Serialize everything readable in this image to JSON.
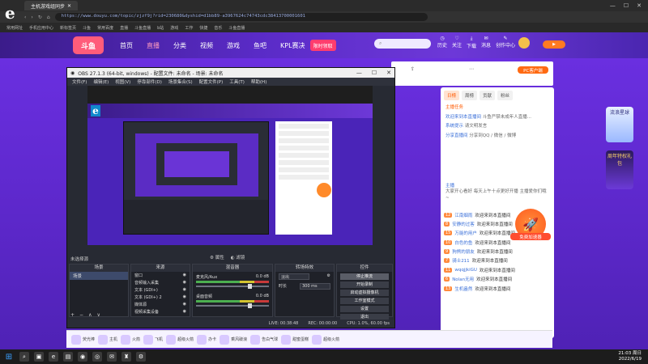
{
  "browser": {
    "tab_title": "主机游戏组同步",
    "url": "https://www.douyu.com/topic/zjzf9j?rid=230680&dyshid=d1bb89-a3967624c74743cdc38413700001601",
    "bookmarks": [
      "常用网址",
      "手机应用中心",
      "新标签页",
      "斗鱼",
      "常用百度",
      "直播",
      "斗鱼直播",
      "b站",
      "游戏",
      "工作",
      "快捷",
      "音乐",
      "斗鱼直播"
    ]
  },
  "site": {
    "brand": "斗鱼",
    "nav": [
      "首页",
      "直播",
      "分类",
      "视频",
      "游戏",
      "鱼吧",
      "KPL赛决"
    ],
    "search_placeholder": "",
    "promo": "限时领取",
    "tools": [
      "历史",
      "关注",
      "下载",
      "消息",
      "创作中心"
    ],
    "pc_button": "PC客户端"
  },
  "chat": {
    "tabs": [
      "日榜",
      "周榜",
      "贡献",
      "粉丝"
    ],
    "banner": "主播任务",
    "messages": [
      {
        "name": "欢迎来到本直播间",
        "text": "斗鱼严禁未成年人直播..."
      },
      {
        "name": "系统提示",
        "text": "请文明发言"
      },
      {
        "name": "分享直播间",
        "text": "分享到QQ / 微信 / 微博"
      }
    ],
    "announce_title": "主播",
    "announce_text": "大家开心看好 每天上午十点更好开播 主播爱你们哦~",
    "rocket_label": "免费加速器",
    "joins": [
      {
        "lv": "12",
        "name": "江南烟雨",
        "text": "欢迎来到本直播间"
      },
      {
        "lv": "8",
        "name": "安静的过客",
        "text": "欢迎来到本直播间"
      },
      {
        "lv": "15",
        "name": "万能的用户",
        "text": "欢迎来到本直播间"
      },
      {
        "lv": "10",
        "name": "白色的鱼",
        "text": "欢迎来到本直播间"
      },
      {
        "lv": "9",
        "name": "狗熊的朋友",
        "text": "欢迎来到本直播间"
      },
      {
        "lv": "7",
        "name": "骑士211",
        "text": "欢迎来到本直播间"
      },
      {
        "lv": "11",
        "name": "wqqjjkiGU",
        "text": "欢迎来到本直播间"
      },
      {
        "lv": "6",
        "name": "Nolan无用",
        "text": "欢迎来到本直播间"
      },
      {
        "lv": "13",
        "name": "生机盎然",
        "text": "欢迎来到本直播间"
      }
    ]
  },
  "side": {
    "promo1": "流浪星球",
    "promo2": "周年特权礼包"
  },
  "obs": {
    "title": "OBS 27.1.3 (64-bit, windows) - 配置文件: 未命名 - 场景: 未命名",
    "menu": [
      "文件(F)",
      "编辑(E)",
      "视图(V)",
      "停靠部件(D)",
      "场景集合(S)",
      "配置文件(P)",
      "工具(T)",
      "帮助(H)"
    ],
    "no_source": "未选择源",
    "props": "属性",
    "filters": "滤镜",
    "scenes_title": "场景",
    "scenes": [
      "场景"
    ],
    "sources_title": "来源",
    "sources": [
      "窗口",
      "音频输入采集",
      "文本 (GDI+)",
      "文本 (GDI+) 2",
      "媒体源",
      "视频采集设备"
    ],
    "mixer_title": "混音器",
    "mixer": [
      {
        "name": "麦克风/Aux",
        "db": "0.0 dB"
      },
      {
        "name": "桌面音频",
        "db": "0.0 dB"
      }
    ],
    "transitions_title": "转场特效",
    "transition": "淡出",
    "duration_label": "时长",
    "duration": "300 ms",
    "controls_title": "控件",
    "controls": [
      "停止推流",
      "开始录制",
      "启动虚拟摄像机",
      "工作室模式",
      "设置",
      "退出"
    ],
    "status": [
      "LIVE: 00:38:48",
      "REC: 00:00:00",
      "CPU: 1.0%, 60.00 fps"
    ]
  },
  "gifts": [
    "荧光棒",
    "主机",
    "火箭",
    "飞机",
    "超级火箭",
    "办卡",
    "乘风破浪",
    "告白气球",
    "甜蜜蛋糕",
    "超级火箭"
  ],
  "taskbar": {
    "time": "21:03 周日",
    "date": "2022/6/19"
  }
}
